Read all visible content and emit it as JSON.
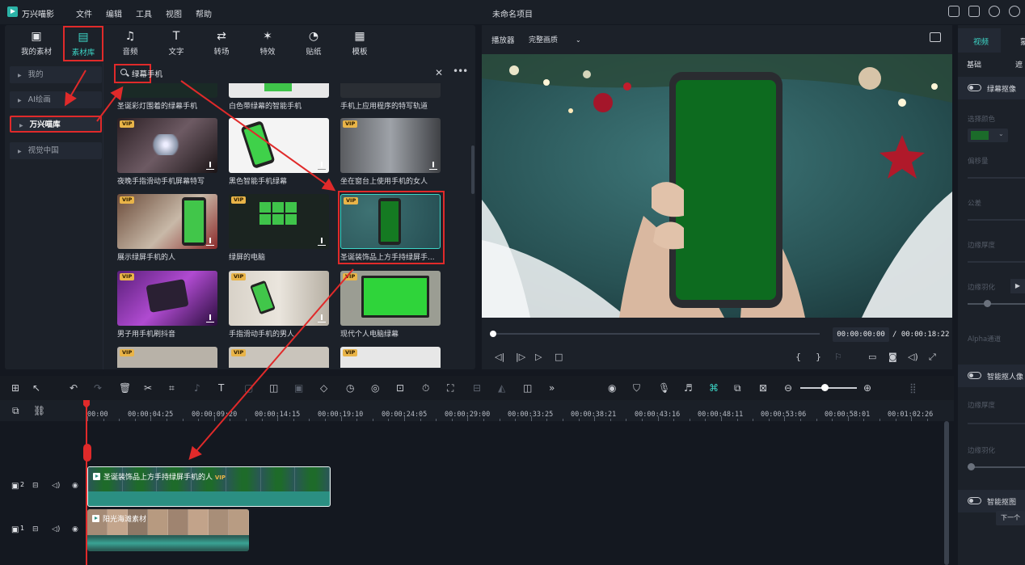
{
  "app": {
    "name": "万兴喵影",
    "title": "未命名项目"
  },
  "menu": [
    "文件",
    "编辑",
    "工具",
    "视图",
    "帮助"
  ],
  "library": {
    "tabs": [
      {
        "label": "我的素材",
        "icon": "image-icon"
      },
      {
        "label": "素材库",
        "icon": "cloud-folder-icon",
        "active": true
      },
      {
        "label": "音频",
        "icon": "music-note-icon"
      },
      {
        "label": "文字",
        "icon": "text-icon"
      },
      {
        "label": "转场",
        "icon": "transition-icon"
      },
      {
        "label": "特效",
        "icon": "sparkle-icon"
      },
      {
        "label": "贴纸",
        "icon": "sticker-icon"
      },
      {
        "label": "模板",
        "icon": "template-icon"
      }
    ],
    "sidebar": [
      {
        "label": "我的",
        "active": false
      },
      {
        "label": "AI绘画",
        "active": false
      },
      {
        "label": "万兴喵库",
        "active": true
      },
      {
        "label": "视觉中国",
        "active": false
      }
    ],
    "search": {
      "value": "绿幕手机"
    },
    "items": [
      {
        "caption": "圣诞彩灯围着的绿幕手机",
        "vip": false
      },
      {
        "caption": "白色带绿幕的智能手机",
        "vip": false
      },
      {
        "caption": "手机上应用程序的特写轨道",
        "vip": false
      },
      {
        "caption": "夜晚手指滑动手机屏幕特写",
        "vip": true
      },
      {
        "caption": "黑色智能手机绿幕",
        "vip": false
      },
      {
        "caption": "坐在窗台上使用手机的女人",
        "vip": true
      },
      {
        "caption": "展示绿屏手机的人",
        "vip": true
      },
      {
        "caption": "绿屏的电脑",
        "vip": true
      },
      {
        "caption": "圣诞装饰品上方手持绿屏手...",
        "vip": true
      },
      {
        "caption": "男子用手机刷抖音",
        "vip": true
      },
      {
        "caption": "手指滑动手机的男人",
        "vip": true
      },
      {
        "caption": "现代个人电脑绿幕",
        "vip": true
      },
      {
        "caption": "",
        "vip": true
      },
      {
        "caption": "",
        "vip": true
      },
      {
        "caption": "",
        "vip": true
      }
    ]
  },
  "player": {
    "label": "播放器",
    "quality": "完整画质",
    "current_time": "00:00:00:00",
    "total_time": "/ 00:00:18:22"
  },
  "props": {
    "tabs": [
      "视频",
      "蒙"
    ],
    "subtabs": [
      "基础",
      "遮"
    ],
    "chroma_key": "绿幕抠像",
    "select_color": "选择颜色",
    "offset": "偏移量",
    "tolerance": "公差",
    "edge_thickness": "边缘厚度",
    "edge_feather": "边缘羽化",
    "alpha": "Alpha通道",
    "smart_portrait": "智能抠人像",
    "edge_thickness2": "边缘厚度",
    "edge_feather2": "边缘羽化",
    "smart_cutout": "智能抠图",
    "tooltip": "下一个",
    "color_hex": "#1b6b2a"
  },
  "timeline": {
    "ticks": [
      "00:00",
      "00:00:04:25",
      "00:00:09:20",
      "00:00:14:15",
      "00:00:19:10",
      "00:00:24:05",
      "00:00:29:00",
      "00:00:33:25",
      "00:00:38:21",
      "00:00:43:16",
      "00:00:48:11",
      "00:00:53:06",
      "00:00:58:01",
      "00:01:02:26"
    ],
    "tracks": [
      {
        "number": "2",
        "clip": "圣诞装饰品上方手持绿屏手机的人",
        "vip": "VIP"
      },
      {
        "number": "1",
        "clip": "阳光海滩素材"
      }
    ]
  },
  "colors": {
    "accent": "#3dd6c7",
    "highlight": "#e02a2a",
    "vip": "#e9b448"
  }
}
